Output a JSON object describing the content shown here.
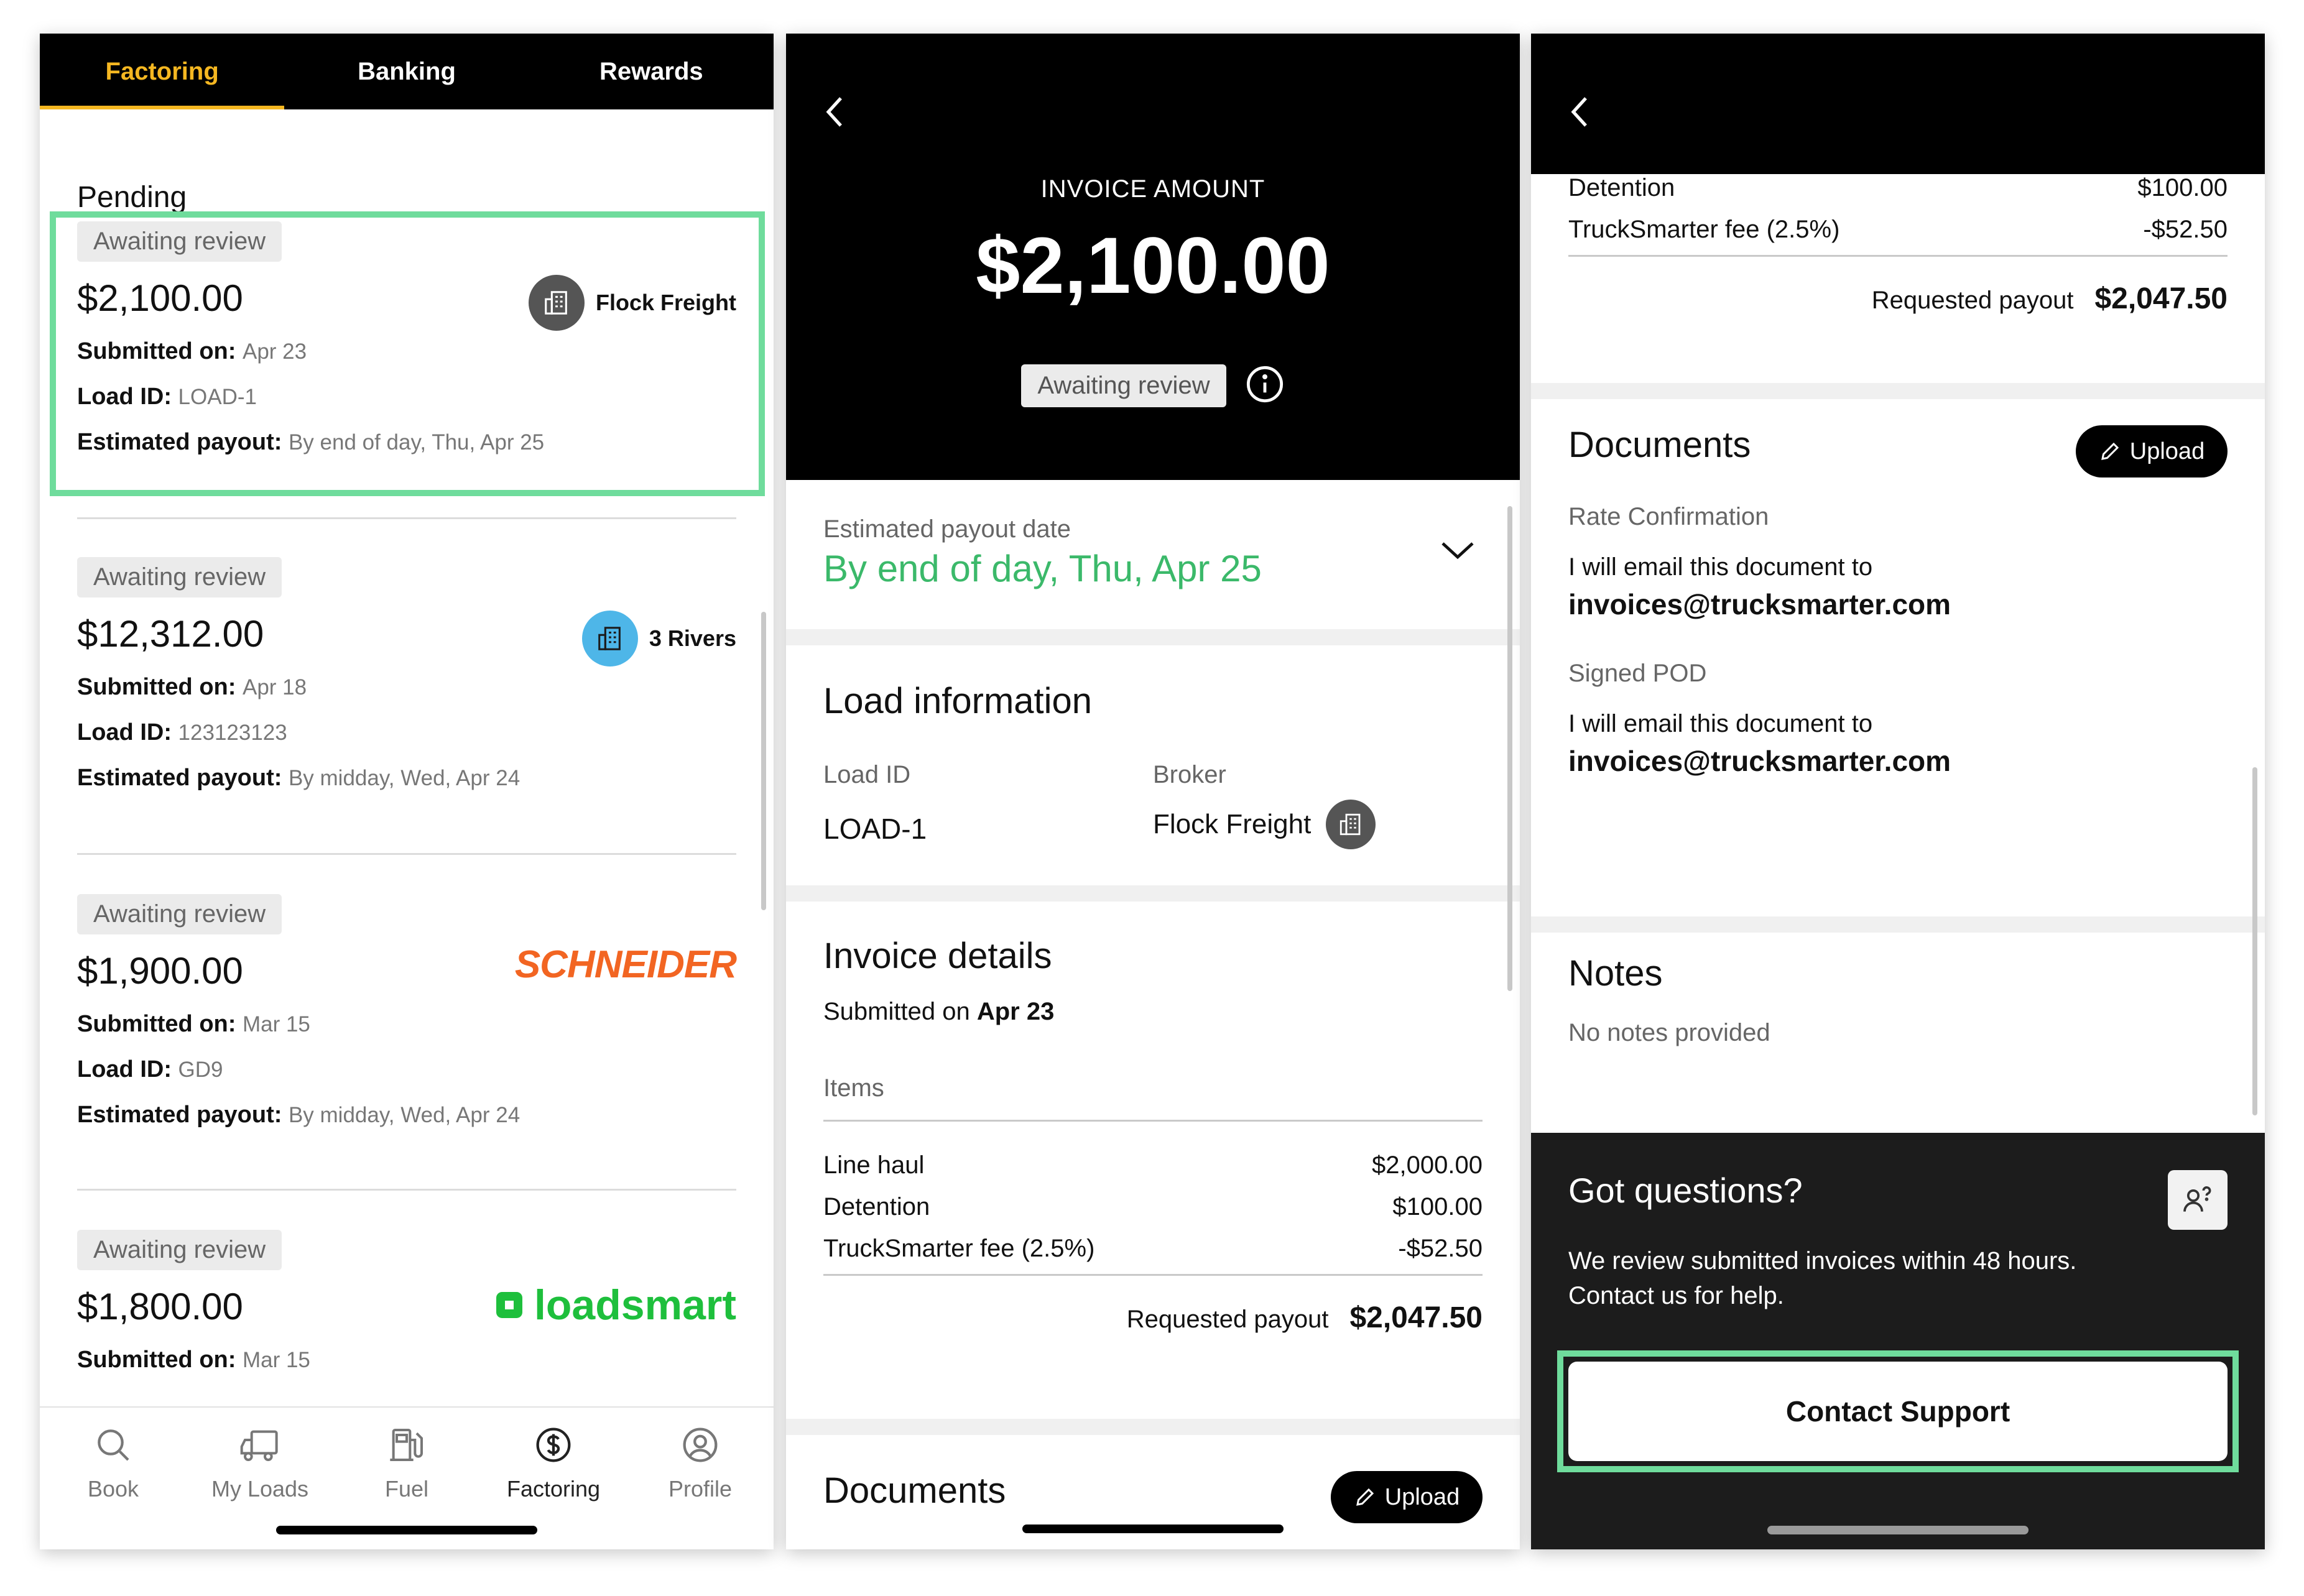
{
  "colors": {
    "accent_yellow": "#f5b721",
    "highlight_green": "#6fdc9c",
    "payout_green": "#3bb96a",
    "schneider_orange": "#f26522",
    "loadsmart_green": "#1ebf3c",
    "three_rivers_blue": "#4eb6e8"
  },
  "phone1": {
    "top_tabs": [
      "Factoring",
      "Banking",
      "Rewards"
    ],
    "section_title": "Pending",
    "labels": {
      "submitted": "Submitted on:",
      "load_id": "Load ID:",
      "estimated": "Estimated payout:"
    },
    "invoices": [
      {
        "status": "Awaiting review",
        "amount": "$2,100.00",
        "broker": "Flock Freight",
        "submitted": "Apr 23",
        "load_id": "LOAD-1",
        "payout": "By end of day, Thu, Apr 25",
        "broker_icon": "building-icon"
      },
      {
        "status": "Awaiting review",
        "amount": "$12,312.00",
        "broker": "3 Rivers",
        "submitted": "Apr 18",
        "load_id": "123123123",
        "payout": "By midday, Wed, Apr 24",
        "broker_icon": "building-icon"
      },
      {
        "status": "Awaiting review",
        "amount": "$1,900.00",
        "broker": "SCHNEIDER",
        "submitted": "Mar 15",
        "load_id": "GD9",
        "payout": "By midday, Wed, Apr 24"
      },
      {
        "status": "Awaiting review",
        "amount": "$1,800.00",
        "broker": "loadsmart",
        "submitted": "Mar 15"
      }
    ],
    "bottom_nav": [
      {
        "label": "Book",
        "icon": "search-icon"
      },
      {
        "label": "My Loads",
        "icon": "truck-icon"
      },
      {
        "label": "Fuel",
        "icon": "fuel-pump-icon"
      },
      {
        "label": "Factoring",
        "icon": "dollar-circle-icon"
      },
      {
        "label": "Profile",
        "icon": "profile-icon"
      }
    ]
  },
  "phone2": {
    "invoice_label": "INVOICE AMOUNT",
    "amount": "$2,100.00",
    "status": "Awaiting review",
    "payout_date_label": "Estimated payout date",
    "payout_date": "By end of day, Thu, Apr 25",
    "load_info_title": "Load information",
    "load_id_label": "Load ID",
    "load_id": "LOAD-1",
    "broker_label": "Broker",
    "broker": "Flock Freight",
    "invoice_details_title": "Invoice details",
    "submitted_prefix": "Submitted on",
    "submitted_date": "Apr 23",
    "items_label": "Items",
    "items": [
      {
        "name": "Line haul",
        "value": "$2,000.00"
      },
      {
        "name": "Detention",
        "value": "$100.00"
      },
      {
        "name": "TruckSmarter fee (2.5%)",
        "value": "-$52.50"
      }
    ],
    "requested_label": "Requested payout",
    "requested_value": "$2,047.50",
    "documents_title": "Documents",
    "upload_label": "Upload"
  },
  "phone3": {
    "items": [
      {
        "name": "Detention",
        "value": "$100.00"
      },
      {
        "name": "TruckSmarter fee (2.5%)",
        "value": "-$52.50"
      }
    ],
    "requested_label": "Requested payout",
    "requested_value": "$2,047.50",
    "documents_title": "Documents",
    "upload_label": "Upload",
    "docs": [
      {
        "name": "Rate Confirmation",
        "text": "I will email this document to",
        "email": "invoices@trucksmarter.com"
      },
      {
        "name": "Signed POD",
        "text": "I will email this document to",
        "email": "invoices@trucksmarter.com"
      }
    ],
    "notes_title": "Notes",
    "notes_text": "No notes provided",
    "questions_title": "Got questions?",
    "questions_line1": "We review submitted invoices within 48 hours.",
    "questions_line2": "Contact us for help.",
    "support_button": "Contact Support"
  }
}
